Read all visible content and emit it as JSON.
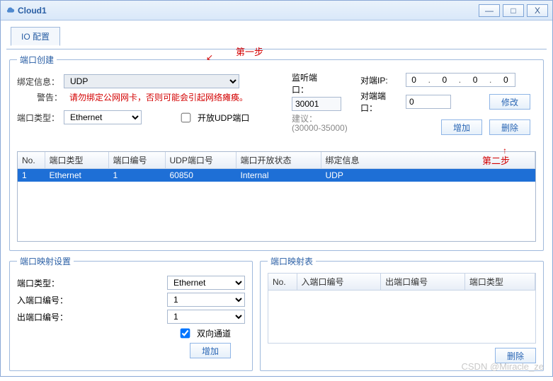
{
  "window": {
    "title": "Cloud1"
  },
  "tab": {
    "io_config": "IO 配置"
  },
  "port_create": {
    "legend": "端口创建",
    "bind_label": "绑定信息：",
    "bind_value": "UDP",
    "warn_label": "警告：",
    "warn_text": "请勿绑定公网网卡，否则可能会引起网络瘫痪。",
    "port_type_label": "端口类型：",
    "port_type_value": "Ethernet",
    "open_udp_label": "开放UDP端口",
    "listen_label": "监听端口：",
    "listen_value": "30001",
    "suggest_label": "建议：",
    "suggest_range": "(30000-35000)",
    "peer_ip_label": "对端IP:",
    "peer_ip_value": [
      "0",
      "0",
      "0",
      "0"
    ],
    "peer_port_label": "对端端口：",
    "peer_port_value": "0",
    "modify_btn": "修改",
    "add_btn": "增加",
    "del_btn": "删除",
    "cols": {
      "no": "No.",
      "ptype": "端口类型",
      "pno": "端口编号",
      "udp": "UDP端口号",
      "open": "端口开放状态",
      "bind": "绑定信息"
    },
    "rows": [
      {
        "no": "1",
        "ptype": "Ethernet",
        "pno": "1",
        "udp": "60850",
        "open": "Internal",
        "bind": "UDP"
      }
    ]
  },
  "map_set": {
    "legend": "端口映射设置",
    "port_type_label": "端口类型：",
    "port_type_value": "Ethernet",
    "in_label": "入端口编号：",
    "in_value": "1",
    "out_label": "出端口编号：",
    "out_value": "1",
    "bidir_label": "双向通道",
    "add_btn": "增加"
  },
  "map_table": {
    "legend": "端口映射表",
    "cols": {
      "no": "No.",
      "in": "入端口编号",
      "out": "出端口编号",
      "ptype": "端口类型"
    },
    "del_btn": "删除"
  },
  "annot": {
    "step1": "第一步",
    "step2": "第二步"
  },
  "watermark": "CSDN @Miracle_ze"
}
